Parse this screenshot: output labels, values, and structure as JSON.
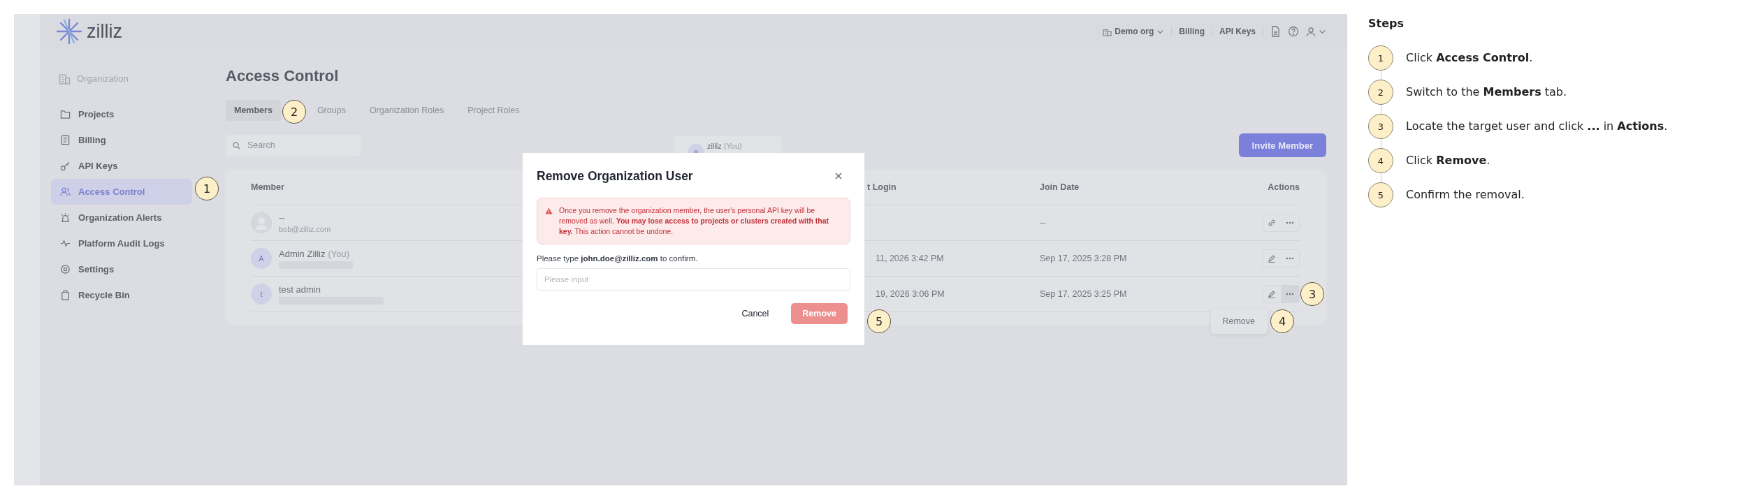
{
  "header": {
    "logo": "zilliz",
    "org": "Demo org",
    "links": [
      "Billing",
      "API Keys"
    ]
  },
  "sidebar": {
    "section": "Organization",
    "items": [
      {
        "label": "Projects",
        "selected": false
      },
      {
        "label": "Billing",
        "selected": false
      },
      {
        "label": "API Keys",
        "selected": false
      },
      {
        "label": "Access Control",
        "selected": true
      },
      {
        "label": "Organization Alerts",
        "selected": false
      },
      {
        "label": "Platform Audit Logs",
        "selected": false
      },
      {
        "label": "Settings",
        "selected": false
      },
      {
        "label": "Recycle Bin",
        "selected": false
      }
    ]
  },
  "page": {
    "title": "Access Control"
  },
  "tabs": [
    {
      "label": "Members",
      "selected": true
    },
    {
      "label": "Groups",
      "selected": false
    },
    {
      "label": "Organization Roles",
      "selected": false
    },
    {
      "label": "Project Roles",
      "selected": false
    }
  ],
  "search": {
    "placeholder": "Search"
  },
  "invite_button": "Invite Member",
  "user_popup": {
    "avatar": "w",
    "name": "zilliz",
    "tag": "(You)"
  },
  "table": {
    "columns": [
      "Member",
      "t Login",
      "Join Date",
      "Actions"
    ],
    "rows": [
      {
        "kind": "invited",
        "name": "--",
        "email": "bob@zilliz.com",
        "join_date": "--"
      },
      {
        "kind": "member",
        "avatar": "A",
        "name": "Admin Zilliz",
        "tag": "(You)",
        "last_login": "11, 2026 3:42 PM",
        "join_date": "Sep 17, 2025 3:28 PM"
      },
      {
        "kind": "member",
        "avatar": "t",
        "name": "test admin",
        "last_login": "19, 2026 3:06 PM",
        "join_date": "Sep 17, 2025 3:25 PM",
        "menu": [
          "Remove"
        ]
      }
    ]
  },
  "modal": {
    "title": "Remove Organization User",
    "warning": "Once you remove the organization member, the user's personal API key will be removed as well. **You may lose access to projects or clusters created with that key.** This action cannot be undone.",
    "prompt": "Please type **john.doe@zilliz.com** to confirm.",
    "placeholder": "Please input",
    "cancel": "Cancel",
    "confirm": "Remove",
    "confirm_disabled": true
  },
  "callouts": [
    {
      "label": "1"
    },
    {
      "label": "2"
    },
    {
      "label": "3"
    },
    {
      "label": "4"
    },
    {
      "label": "5"
    }
  ],
  "steps": {
    "title": "Steps",
    "items": [
      {
        "number": "1",
        "text": "Click **Access Control**."
      },
      {
        "number": "2",
        "text": "Switch to the **Members** tab."
      },
      {
        "number": "3",
        "text": "Locate the target user and click **...** in **Actions**."
      },
      {
        "number": "4",
        "text": "Click **Remove**."
      },
      {
        "number": "5",
        "text": "Confirm the removal."
      }
    ]
  }
}
